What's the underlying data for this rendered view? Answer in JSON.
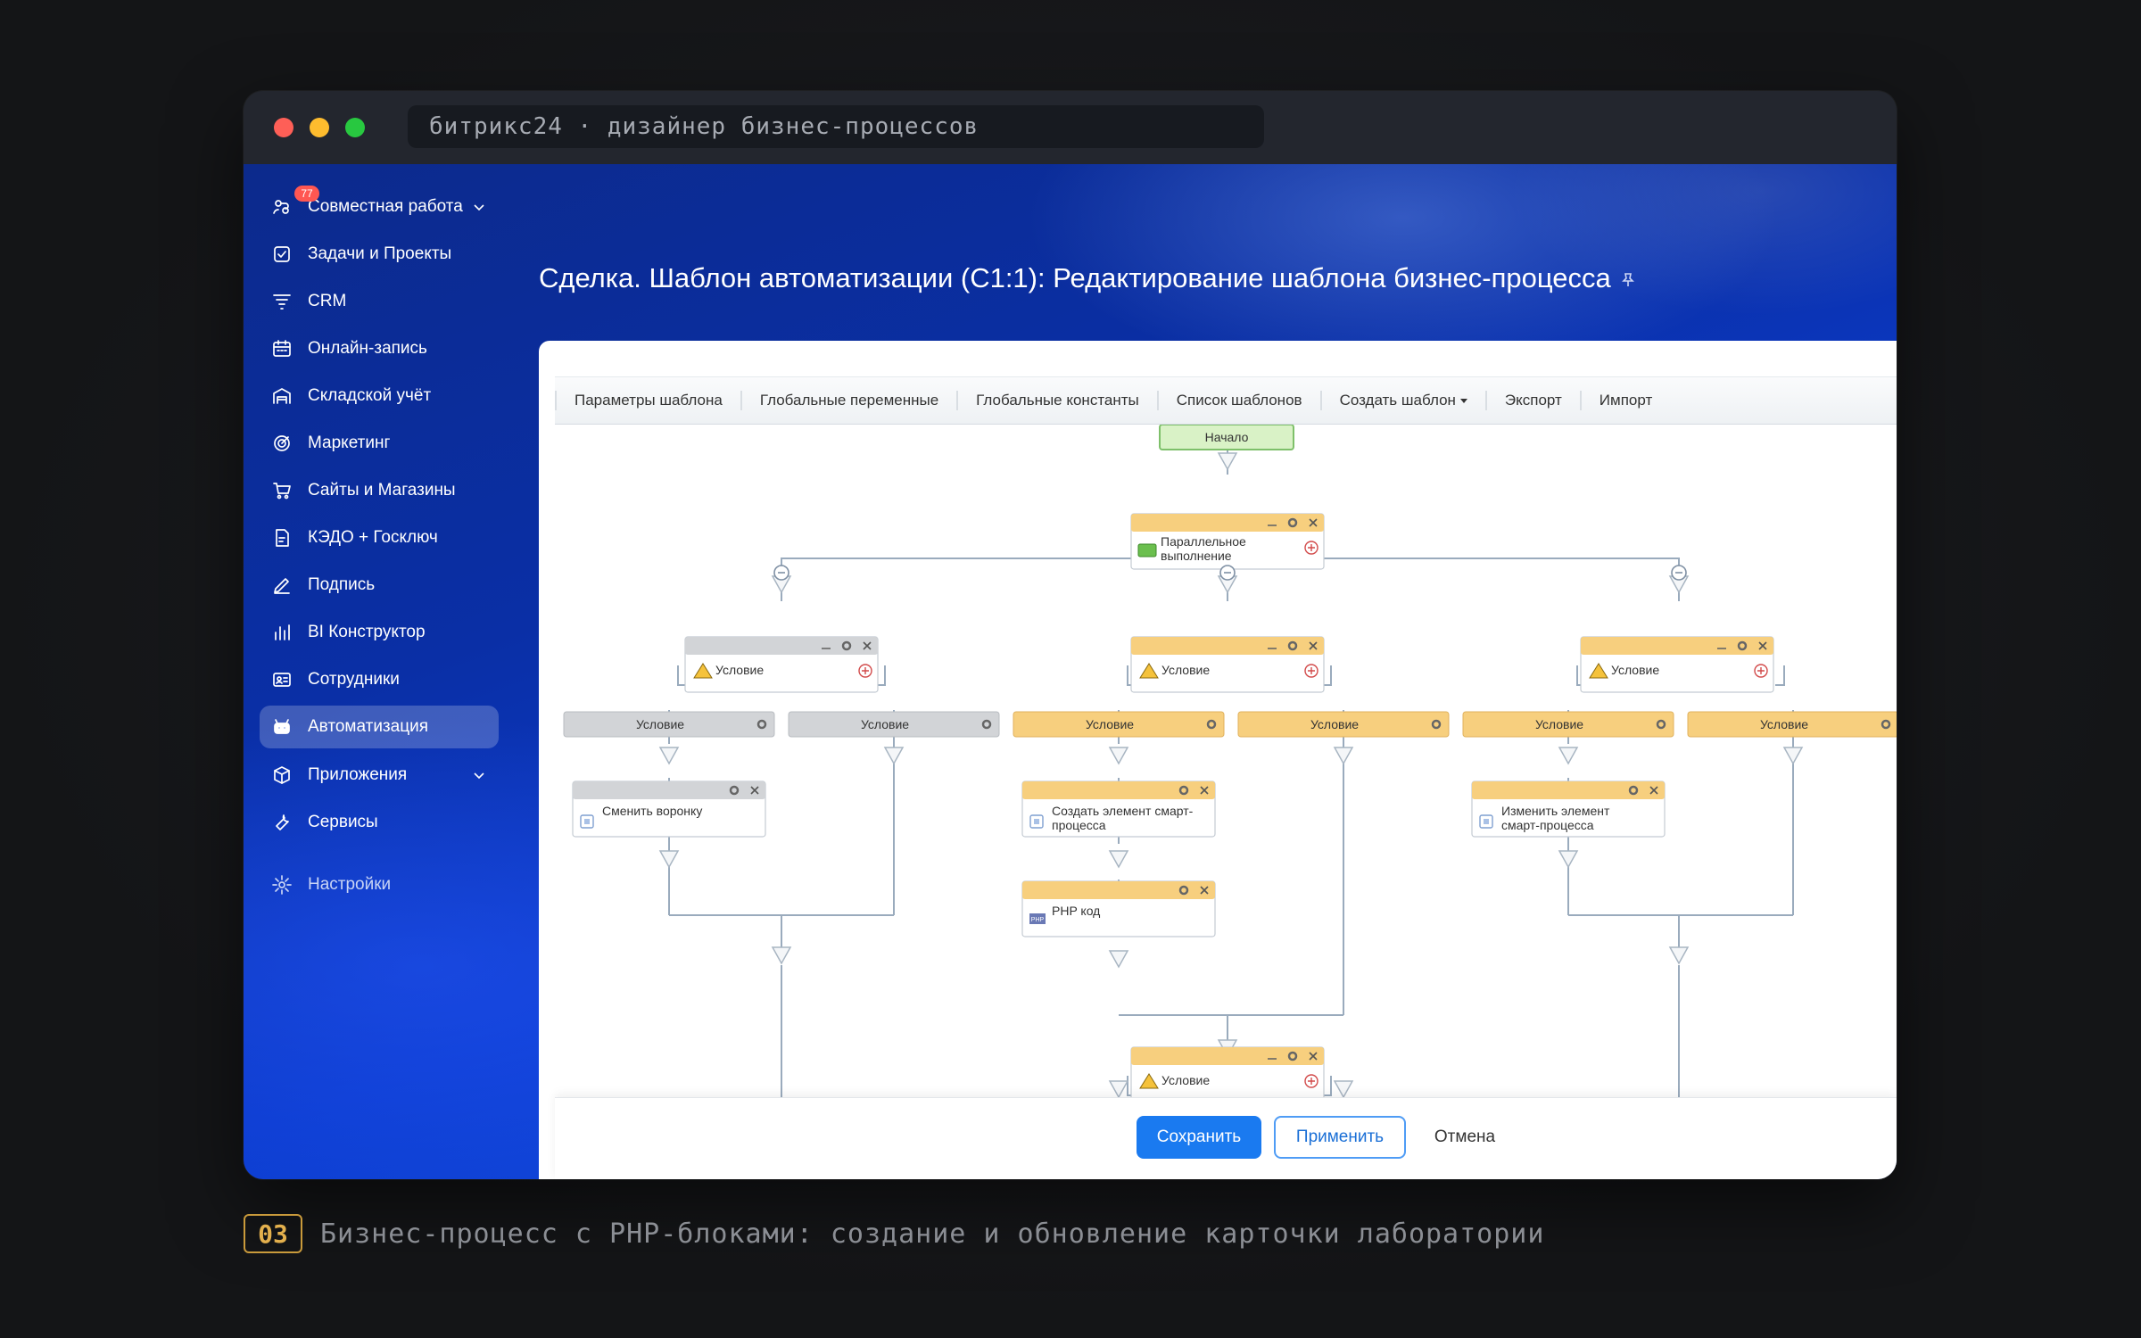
{
  "window": {
    "address_text": "битрикс24 · дизайнер бизнес-процессов"
  },
  "sidebar": {
    "items": [
      {
        "label": "Совместная работа",
        "icon": "people-icon",
        "badge": "77",
        "has_chevron": true
      },
      {
        "label": "Задачи и Проекты",
        "icon": "task-check-icon"
      },
      {
        "label": "CRM",
        "icon": "funnel-icon"
      },
      {
        "label": "Онлайн-запись",
        "icon": "calendar-icon"
      },
      {
        "label": "Складской учёт",
        "icon": "warehouse-icon"
      },
      {
        "label": "Маркетинг",
        "icon": "target-icon"
      },
      {
        "label": "Сайты и Магазины",
        "icon": "cart-icon"
      },
      {
        "label": "КЭДО + Госключ",
        "icon": "document-sign-icon"
      },
      {
        "label": "Подпись",
        "icon": "pen-icon"
      },
      {
        "label": "BI Конструктор",
        "icon": "bar-chart-icon"
      },
      {
        "label": "Сотрудники",
        "icon": "id-card-icon"
      },
      {
        "label": "Автоматизация",
        "icon": "robot-icon",
        "active": true
      },
      {
        "label": "Приложения",
        "icon": "cube-icon",
        "has_chevron": true
      },
      {
        "label": "Сервисы",
        "icon": "wrench-icon"
      },
      {
        "label": "Настройки",
        "icon": "gear-icon"
      }
    ]
  },
  "page": {
    "title": "Сделка. Шаблон автоматизации (C1:1): Редактирование шаблона бизнес-процесса"
  },
  "toolbar": {
    "items": [
      "Параметры шаблона",
      "Глобальные переменные",
      "Глобальные константы",
      "Список шаблонов",
      "Создать шаблон",
      "Экспорт",
      "Импорт"
    ],
    "dropdown_index": 4
  },
  "workflow": {
    "start_label": "Начало",
    "parallel_label": [
      "Параллельное",
      "выполнение"
    ],
    "condition_label": "Условие",
    "branch_label": "Условие",
    "activities": {
      "change_funnel": "Сменить воронку",
      "create_element": [
        "Создать элемент смарт-",
        "процесса"
      ],
      "php_code": "PHP код",
      "php_icon_text": "PHP",
      "update_element": [
        "Изменить элемент",
        "смарт-процесса"
      ]
    },
    "colors": {
      "active": "#f7cf7e",
      "disabled": "#d2d4d7",
      "start": "#d9f2c6",
      "line": "#9aabbd"
    }
  },
  "footer": {
    "save": "Сохранить",
    "apply": "Применить",
    "cancel": "Отмена"
  },
  "caption": {
    "number": "03",
    "text": "Бизнес-процесс с PHP-блоками: создание и обновление карточки лаборатории"
  }
}
